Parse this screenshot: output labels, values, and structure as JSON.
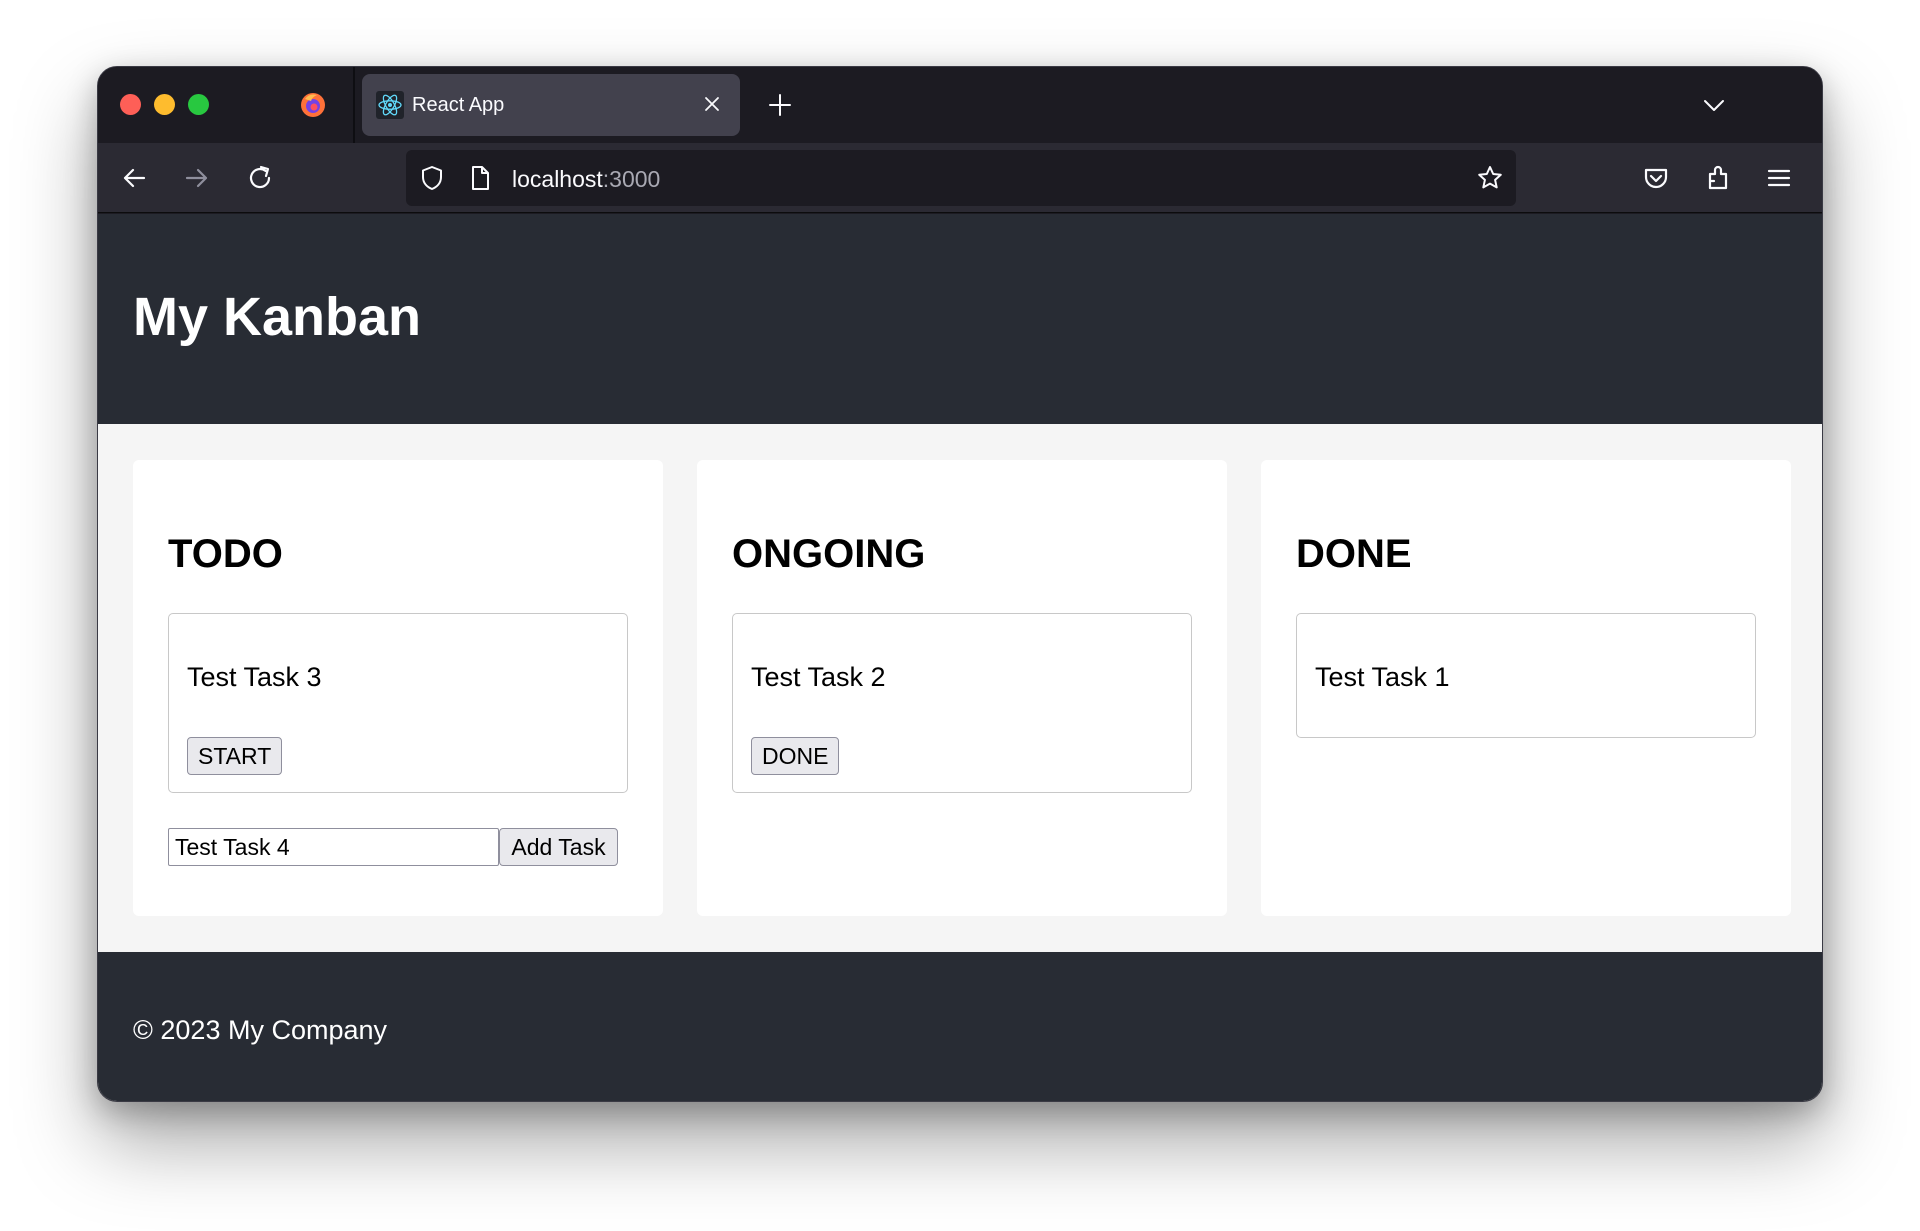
{
  "browser": {
    "tab_title": "React App",
    "url_host": "localhost",
    "url_port": ":3000",
    "icons": {
      "back": "arrow-left-icon",
      "forward": "arrow-right-icon",
      "reload": "reload-icon",
      "pocket": "pocket-icon",
      "extensions": "extensions-icon",
      "menu": "hamburger-menu-icon"
    }
  },
  "app": {
    "title": "My Kanban",
    "columns": [
      {
        "title": "TODO",
        "tasks": [
          {
            "title": "Test Task 3",
            "action": "START"
          }
        ],
        "new_task_value": "Test Task 4",
        "add_label": "Add Task"
      },
      {
        "title": "ONGOING",
        "tasks": [
          {
            "title": "Test Task 2",
            "action": "DONE"
          }
        ]
      },
      {
        "title": "DONE",
        "tasks": [
          {
            "title": "Test Task 1"
          }
        ]
      }
    ],
    "footer": "© 2023 My Company"
  }
}
